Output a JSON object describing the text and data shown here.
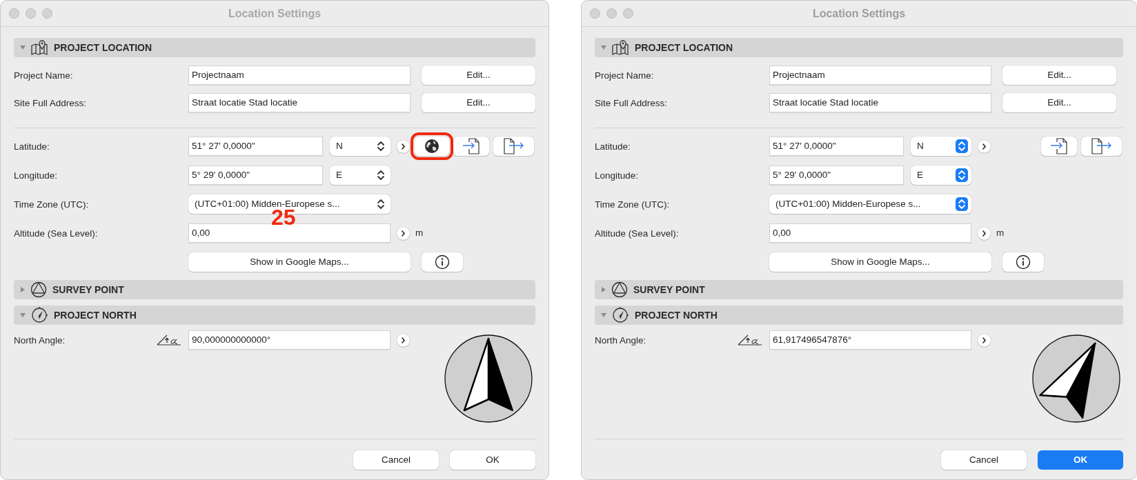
{
  "dialogs": [
    {
      "title": "Location Settings",
      "active": false,
      "annotation": "25",
      "project_location": {
        "title": "PROJECT LOCATION",
        "expanded": true,
        "project_name": {
          "label": "Project Name:",
          "value": "Projectnaam",
          "button": "Edit..."
        },
        "site_address": {
          "label": "Site Full Address:",
          "value": "Straat locatie Stad locatie",
          "button": "Edit..."
        },
        "latitude": {
          "label": "Latitude:",
          "value": "51° 27' 0,0000\"",
          "hemisphere": "N"
        },
        "location_buttons": [
          {
            "kind": "globe",
            "highlighted": true
          },
          {
            "kind": "import",
            "highlighted": false
          },
          {
            "kind": "export",
            "highlighted": false
          }
        ],
        "longitude": {
          "label": "Longitude:",
          "value": "5° 29' 0,0000\"",
          "hemisphere": "E"
        },
        "time_zone": {
          "label": "Time Zone (UTC):",
          "value": "(UTC+01:00) Midden-Europese s..."
        },
        "altitude": {
          "label": "Altitude (Sea Level):",
          "value": "0,00",
          "unit": "m"
        },
        "maps_button": "Show in Google Maps..."
      },
      "survey_point": {
        "title": "SURVEY POINT",
        "expanded": false
      },
      "project_north": {
        "title": "PROJECT NORTH",
        "expanded": true,
        "label": "North Angle:",
        "value": "90,000000000000°"
      },
      "buttons": [
        {
          "label": "Cancel",
          "kind": "cancel"
        },
        {
          "label": "OK",
          "kind": "ok"
        }
      ]
    },
    {
      "title": "Location Settings",
      "active": true,
      "project_location": {
        "title": "PROJECT LOCATION",
        "expanded": true,
        "project_name": {
          "label": "Project Name:",
          "value": "Projectnaam",
          "button": "Edit..."
        },
        "site_address": {
          "label": "Site Full Address:",
          "value": "Straat locatie Stad locatie",
          "button": "Edit..."
        },
        "latitude": {
          "label": "Latitude:",
          "value": "51° 27' 0,0000\"",
          "hemisphere": "N"
        },
        "location_buttons": [
          {
            "kind": "import",
            "highlighted": false
          },
          {
            "kind": "export",
            "highlighted": false
          }
        ],
        "longitude": {
          "label": "Longitude:",
          "value": "5° 29' 0,0000\"",
          "hemisphere": "E"
        },
        "time_zone": {
          "label": "Time Zone (UTC):",
          "value": "(UTC+01:00) Midden-Europese s..."
        },
        "altitude": {
          "label": "Altitude (Sea Level):",
          "value": "0,00",
          "unit": "m"
        },
        "maps_button": "Show in Google Maps..."
      },
      "survey_point": {
        "title": "SURVEY POINT",
        "expanded": false
      },
      "project_north": {
        "title": "PROJECT NORTH",
        "expanded": true,
        "label": "North Angle:",
        "value": "61,917496547876°"
      },
      "buttons": [
        {
          "label": "Cancel",
          "kind": "cancel"
        },
        {
          "label": "OK",
          "kind": "ok"
        }
      ]
    }
  ]
}
